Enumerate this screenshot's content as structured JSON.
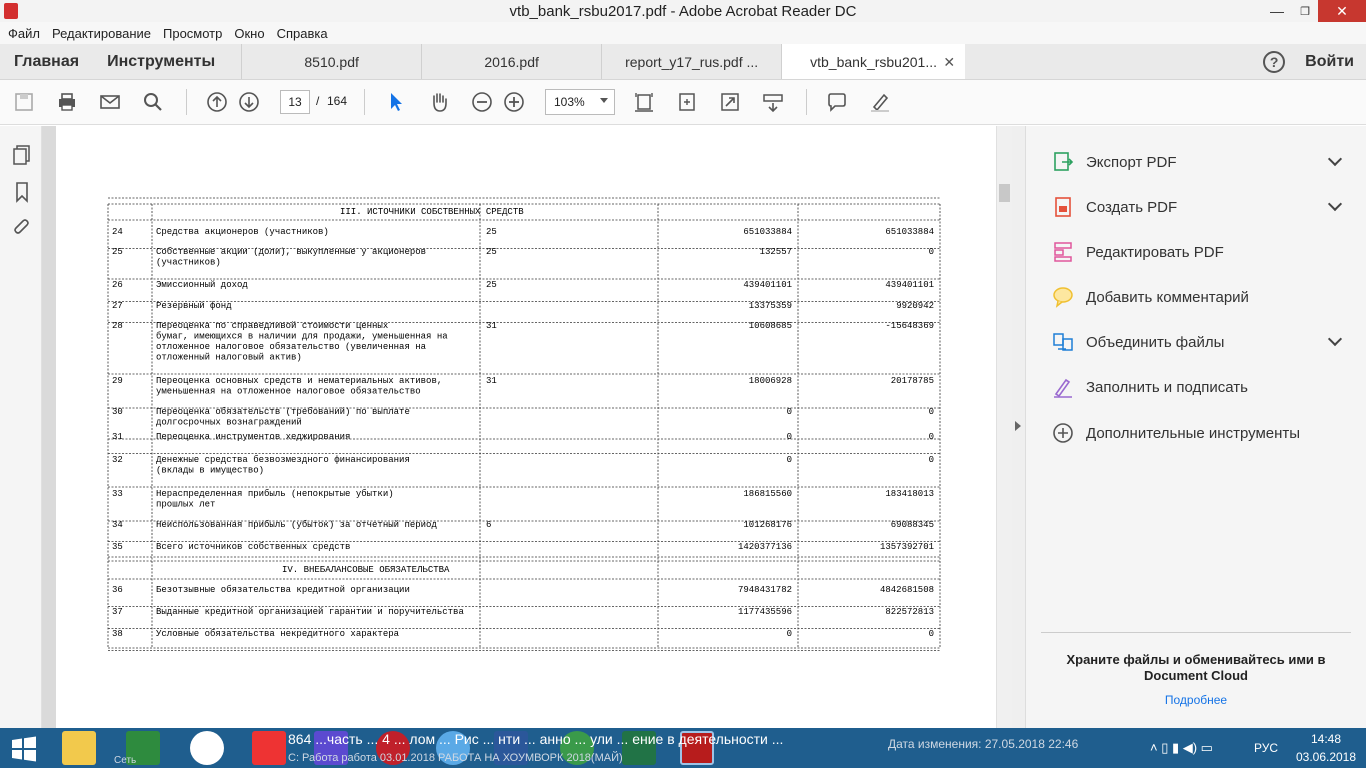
{
  "window": {
    "title": "vtb_bank_rsbu2017.pdf - Adobe Acrobat Reader DC"
  },
  "menu": [
    "Файл",
    "Редактирование",
    "Просмотр",
    "Окно",
    "Справка"
  ],
  "tabs": {
    "home": "Главная",
    "tools": "Инструменты",
    "docs": [
      "8510.pdf",
      "2016.pdf",
      "report_y17_rus.pdf ...",
      "vtb_bank_rsbu201..."
    ],
    "login": "Войти",
    "help": "?"
  },
  "toolbar": {
    "page_current": "13",
    "page_sep": "/",
    "page_total": "164",
    "zoom": "103%"
  },
  "doc": {
    "section3": "III. ИСТОЧНИКИ СОБСТВЕННЫХ СРЕДСТВ",
    "section4": "IV. ВНЕБАЛАНСОВЫЕ ОБЯЗАТЕЛЬСТВА",
    "rows": [
      {
        "n": "24",
        "name": [
          "Средства акционеров (участников)"
        ],
        "note": "25",
        "v1": "651033884",
        "v2": "651033884"
      },
      {
        "n": "25",
        "name": [
          "Собственные акции (доли), выкупленные у акционеров",
          "(участников)"
        ],
        "note": "25",
        "v1": "132557",
        "v2": "0"
      },
      {
        "n": "26",
        "name": [
          "Эмиссионный доход"
        ],
        "note": "25",
        "v1": "439401101",
        "v2": "439401101"
      },
      {
        "n": "27",
        "name": [
          "Резервный фонд"
        ],
        "note": "",
        "v1": "13375359",
        "v2": "9920942"
      },
      {
        "n": "28",
        "name": [
          "Переоценка по справедливой стоимости ценных",
          "бумаг, имеющихся в наличии для продажи, уменьшенная на",
          "отложенное налоговое обязательство (увеличенная на",
          "отложенный налоговый актив)"
        ],
        "note": "31",
        "v1": "10608685",
        "v2": "-15648369"
      },
      {
        "n": "29",
        "name": [
          "Переоценка основных средств и нематериальных активов,",
          "уменьшенная на отложенное налоговое обязательство"
        ],
        "note": "31",
        "v1": "18006928",
        "v2": "20178785"
      },
      {
        "n": "30",
        "name": [
          "Переоценка обязательств (требований) по выплате",
          "долгосрочных вознаграждений"
        ],
        "note": "",
        "v1": "0",
        "v2": "0"
      },
      {
        "n": "31",
        "name": [
          "Переоценка инструментов хеджирования"
        ],
        "note": "",
        "v1": "0",
        "v2": "0"
      },
      {
        "n": "32",
        "name": [
          "Денежные средства безвозмездного финансирования",
          "(вклады в имущество)"
        ],
        "note": "",
        "v1": "0",
        "v2": "0"
      },
      {
        "n": "33",
        "name": [
          "Нераспределенная прибыль (непокрытые убытки)",
          "прошлых лет"
        ],
        "note": "",
        "v1": "186815560",
        "v2": "183418013"
      },
      {
        "n": "34",
        "name": [
          "Неиспользованная прибыль (убыток) за отчетный период"
        ],
        "note": "6",
        "v1": "101268176",
        "v2": "69088345"
      },
      {
        "n": "35",
        "name": [
          "Всего источников собственных средств"
        ],
        "note": "",
        "v1": "1420377136",
        "v2": "1357392701"
      },
      {
        "n": "36",
        "name": [
          "Безотзывные обязательства кредитной организации"
        ],
        "note": "",
        "v1": "7948431782",
        "v2": "4842681508"
      },
      {
        "n": "37",
        "name": [
          "Выданные кредитной организацией гарантии и поручительства"
        ],
        "note": "",
        "v1": "1177435596",
        "v2": "822572813"
      },
      {
        "n": "38",
        "name": [
          "Условные обязательства некредитного характера"
        ],
        "note": "",
        "v1": "0",
        "v2": "0"
      }
    ]
  },
  "right_panel": {
    "items": [
      {
        "label": "Экспорт PDF",
        "icon": "export-pdf-icon",
        "color": "#2da160",
        "chevron": true
      },
      {
        "label": "Создать PDF",
        "icon": "create-pdf-icon",
        "color": "#e4513b",
        "chevron": true
      },
      {
        "label": "Редактировать PDF",
        "icon": "edit-pdf-icon",
        "color": "#e0569c",
        "chevron": false
      },
      {
        "label": "Добавить комментарий",
        "icon": "comment-icon",
        "color": "#f0c030",
        "chevron": false
      },
      {
        "label": "Объединить файлы",
        "icon": "combine-icon",
        "color": "#1e7fd6",
        "chevron": true
      },
      {
        "label": "Заполнить и подписать",
        "icon": "sign-icon",
        "color": "#9a6ad0",
        "chevron": false
      },
      {
        "label": "Дополнительные инструменты",
        "icon": "more-tools-icon",
        "color": "#555555",
        "chevron": false
      }
    ],
    "cloud_text": "Храните файлы и обменивайтесь ими в Document Cloud",
    "more_link": "Подробнее"
  },
  "taskbar": {
    "file_label": "864 ...часть ... 4 ... лом ... Рис ... нти ... анно ... ули ... ение в деятельности ...",
    "path_label": "С: Работа работа 03.01.2018 РАБОТА НА ХОУМВОРК 2018(МАЙ)",
    "modified": "Дата изменения: 27.05.2018 22:46",
    "lang": "РУС",
    "time": "14:48",
    "date": "03.06.2018",
    "extra_left": "Сеть"
  },
  "colors": {
    "accent": "#1473e6",
    "taskbar": "#1f5e8e",
    "close": "#c7372f"
  }
}
